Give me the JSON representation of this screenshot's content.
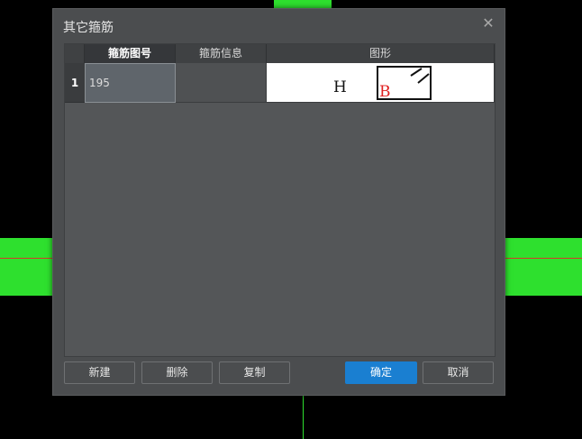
{
  "dialog": {
    "title": "其它箍筋",
    "close_icon": "close-icon"
  },
  "table": {
    "headers": [
      "箍筋图号",
      "箍筋信息",
      "图形"
    ],
    "rows": [
      {
        "index": "1",
        "code": "195",
        "info": "",
        "shape": {
          "label_h": "H",
          "label_b": "B"
        }
      }
    ]
  },
  "buttons": {
    "new": "新建",
    "delete": "删除",
    "copy": "复制",
    "ok": "确定",
    "cancel": "取消"
  },
  "colors": {
    "accent": "#1a7fd1",
    "canvas_green": "#2ee02e",
    "shape_label_b": "#e02020"
  }
}
